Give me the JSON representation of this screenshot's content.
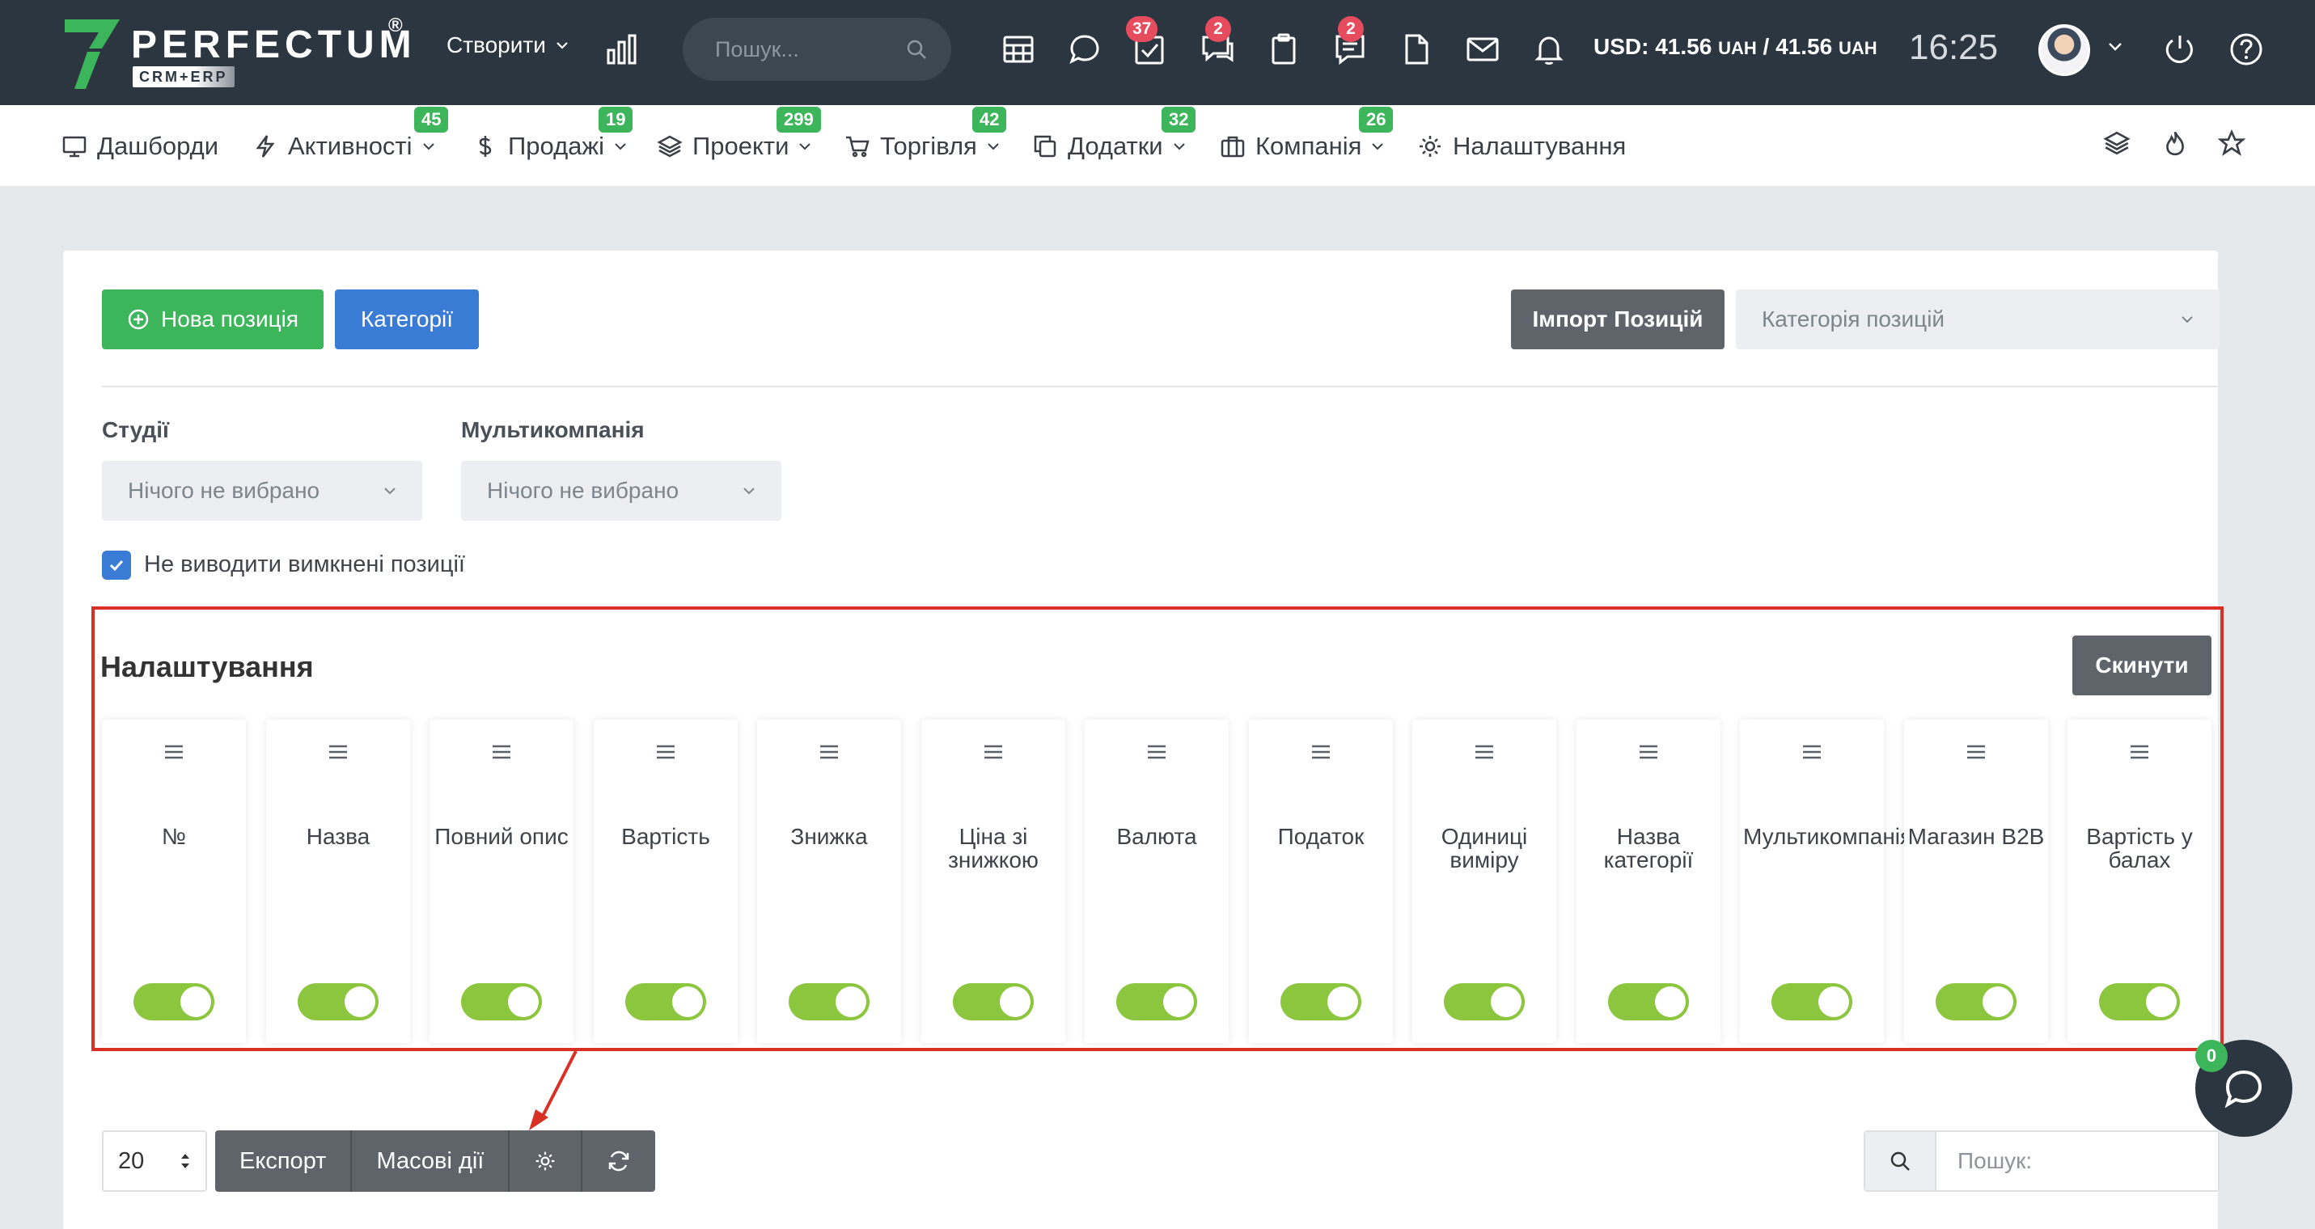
{
  "topbar": {
    "logo_text": "PERFECTUM",
    "logo_sub": "CRM+ERP",
    "logo_reg": "®",
    "create_label": "Створити",
    "search_placeholder": "Пошук...",
    "badges": {
      "tasks": "37",
      "chat": "2",
      "notes": "2"
    },
    "rate_usd": "USD: 41.56",
    "rate_uah_a": "UAH",
    "rate_sep": "/ 41.56",
    "rate_uah_b": "UAH",
    "time": "16:25"
  },
  "nav": {
    "items": [
      {
        "label": "Дашборди",
        "icon": "dashboard-icon",
        "badge": ""
      },
      {
        "label": "Активності",
        "icon": "bolt-icon",
        "badge": "45"
      },
      {
        "label": "Продажі",
        "icon": "dollar-icon",
        "badge": "19"
      },
      {
        "label": "Проекти",
        "icon": "layers-icon",
        "badge": "299"
      },
      {
        "label": "Торгівля",
        "icon": "cart-icon",
        "badge": "42"
      },
      {
        "label": "Додатки",
        "icon": "copy-icon",
        "badge": "32"
      },
      {
        "label": "Компанія",
        "icon": "briefcase-icon",
        "badge": "26"
      },
      {
        "label": "Налаштування",
        "icon": "gear-icon",
        "badge": ""
      }
    ]
  },
  "toolbar": {
    "new_position": "Нова позиція",
    "categories": "Категорії",
    "import": "Імпорт Позицій",
    "category_placeholder": "Категорія позицій"
  },
  "filters": {
    "studio_label": "Студії",
    "studio_value": "Нічого не вибрано",
    "multicompany_label": "Мультикомпанія",
    "multicompany_value": "Нічого не вибрано",
    "hide_disabled_label": "Не виводити вимкнені позиції",
    "hide_disabled_checked": true
  },
  "settings": {
    "title": "Налаштування",
    "reset": "Скинути",
    "columns": [
      {
        "name": "№",
        "enabled": true
      },
      {
        "name": "Назва",
        "enabled": true
      },
      {
        "name": "Повний опис",
        "enabled": true
      },
      {
        "name": "Вартість",
        "enabled": true
      },
      {
        "name": "Знижка",
        "enabled": true
      },
      {
        "name": "Ціна зі знижкою",
        "enabled": true
      },
      {
        "name": "Валюта",
        "enabled": true
      },
      {
        "name": "Податок",
        "enabled": true
      },
      {
        "name": "Одиниці виміру",
        "enabled": true
      },
      {
        "name": "Назва категорії",
        "enabled": true
      },
      {
        "name": "Мультикомпанія",
        "enabled": true
      },
      {
        "name": "Магазин B2B",
        "enabled": true
      },
      {
        "name": "Вартість у балах",
        "enabled": true
      }
    ]
  },
  "table_controls": {
    "page_length": "20",
    "export": "Експорт",
    "bulk_actions": "Масові дії",
    "search_placeholder": "Пошук:"
  },
  "chat": {
    "badge": "0"
  },
  "colors": {
    "topbar": "#2c3640",
    "green": "#3cb55b",
    "blue": "#3a7bd5",
    "toggle_on": "#8cc63f",
    "highlight": "#d93025"
  }
}
